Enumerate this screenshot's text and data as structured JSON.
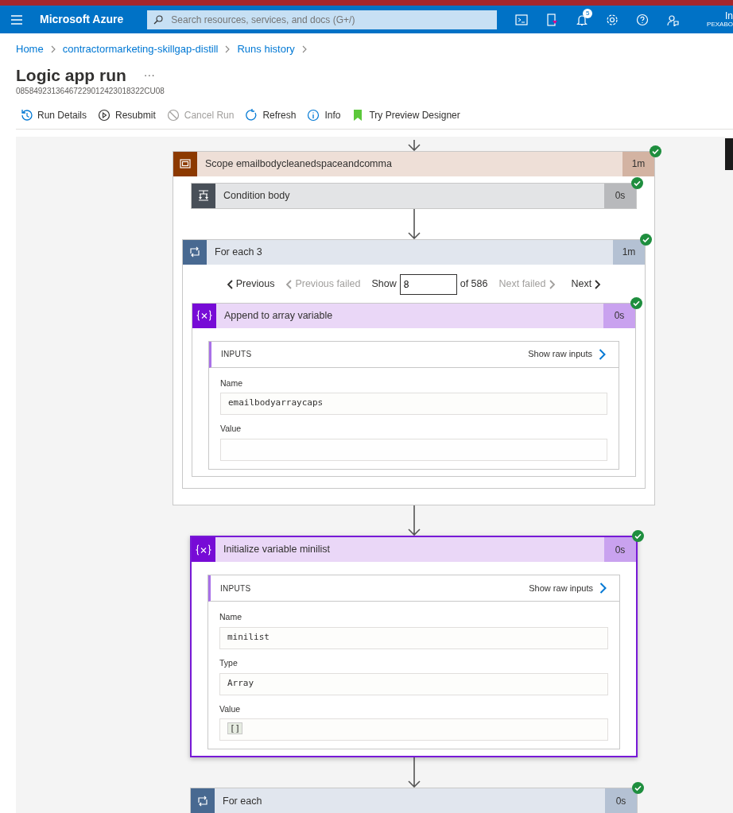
{
  "topbar": {
    "brand": "Microsoft Azure",
    "search": {
      "placeholder": "Search resources, services, and docs (G+/)"
    },
    "notification_count": "5",
    "account_name": "In",
    "account_org": "PEXABO"
  },
  "breadcrumb": [
    "Home",
    "contractormarketing-skillgap-distill",
    "Runs history"
  ],
  "page": {
    "title": "Logic app run",
    "more": "···",
    "run_id": "08584923136467229012423018322CU08"
  },
  "toolbar": [
    {
      "label": "Run Details",
      "disabled": false
    },
    {
      "label": "Resubmit",
      "disabled": false
    },
    {
      "label": "Cancel Run",
      "disabled": true
    },
    {
      "label": "Refresh",
      "disabled": false
    },
    {
      "label": "Info",
      "disabled": false
    },
    {
      "label": "Try Preview Designer",
      "disabled": false
    }
  ],
  "flow": [
    {
      "kind": "scope",
      "title": "Scope emailbodycleanedspaceandcomma",
      "duration": "1m",
      "succeeded": true,
      "selected": false,
      "children": [
        {
          "kind": "condition",
          "title": "Condition body",
          "duration": "0s",
          "succeeded": true,
          "selected": false
        },
        {
          "kind": "foreach",
          "title": "For each 3",
          "duration": "1m",
          "succeeded": true,
          "selected": false,
          "pager": {
            "previous": "Previous",
            "previous_failed": "Previous failed",
            "show": "Show",
            "index": "8",
            "of": "of 586",
            "next_failed": "Next failed",
            "next": "Next"
          },
          "children": [
            {
              "kind": "variable",
              "title": "Append to array variable",
              "duration": "0s",
              "succeeded": true,
              "selected": false,
              "inputs": {
                "heading": "INPUTS",
                "raw_link": "Show raw inputs",
                "fields": [
                  {
                    "label": "Name",
                    "kind": "text",
                    "value": "emailbodyarraycaps"
                  },
                  {
                    "label": "Value",
                    "kind": "text"
                  }
                ]
              }
            }
          ]
        }
      ]
    },
    {
      "kind": "variable",
      "title": "Initialize variable minilist",
      "duration": "0s",
      "succeeded": true,
      "selected": true,
      "inputs": {
        "heading": "INPUTS",
        "raw_link": "Show raw inputs",
        "fields": [
          {
            "label": "Name",
            "kind": "text",
            "value": "minilist"
          },
          {
            "label": "Type",
            "kind": "text",
            "value": "Array"
          },
          {
            "label": "Value",
            "kind": "token",
            "value": "[]"
          }
        ]
      }
    },
    {
      "kind": "foreach",
      "title": "For each",
      "duration": "0s",
      "succeeded": true,
      "selected": false
    }
  ]
}
